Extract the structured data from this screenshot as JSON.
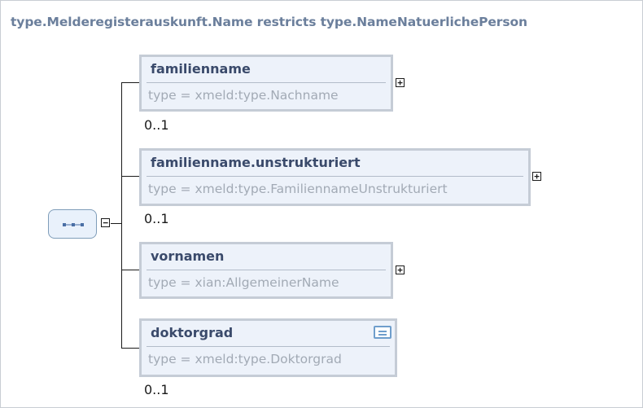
{
  "diagram": {
    "title": "type.Melderegisterauskunft.Name restricts type.NameNatuerlichePerson",
    "sequence": {
      "icon": "sequence-compositor-icon",
      "toggle": "−"
    },
    "elements": [
      {
        "name": "familienname",
        "type": "type = xmeld:type.Nachname",
        "occurs": "0..1",
        "toggle": "+"
      },
      {
        "name": "familienname.unstrukturiert",
        "type": "type = xmeld:type.FamiliennameUnstrukturiert",
        "occurs": "0..1",
        "toggle": "+"
      },
      {
        "name": "vornamen",
        "type": "type = xian:AllgemeinerName",
        "occurs": "",
        "toggle": "+"
      },
      {
        "name": "doktorgrad",
        "type": "type = xmeld:type.Doktorgrad",
        "occurs": "0..1",
        "icon": "documentation-icon"
      }
    ],
    "colors": {
      "title": "#6b7f9c",
      "element_border": "#c5ccd6",
      "element_fill": "#edf2fa",
      "element_name": "#3a4a6b",
      "type_text": "#a2aab5",
      "sequence_border": "#7f9db9",
      "doc_icon": "#6f9ecc"
    }
  }
}
